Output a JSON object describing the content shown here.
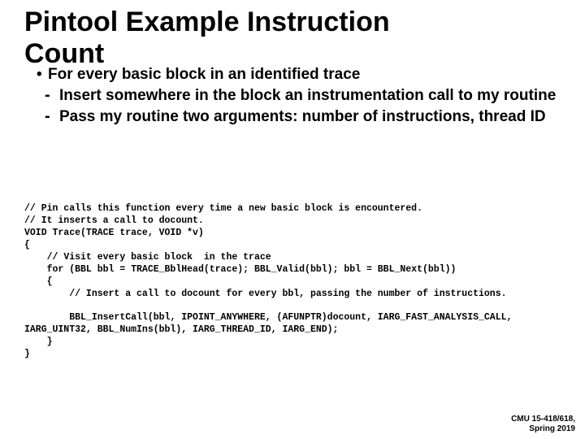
{
  "title_line1": "Pintool Example Instruction",
  "title_line2": "Count",
  "bullet_main": "For every basic block in an identified trace",
  "sub1": "Insert somewhere in the block an instrumentation call to my routine",
  "sub2": "Pass my routine two arguments: number of instructions, thread ID",
  "code": "// Pin calls this function every time a new basic block is encountered.\n// It inserts a call to docount.\nVOID Trace(TRACE trace, VOID *v)\n{\n    // Visit every basic block  in the trace\n    for (BBL bbl = TRACE_BblHead(trace); BBL_Valid(bbl); bbl = BBL_Next(bbl))\n    {\n        // Insert a call to docount for every bbl, passing the number of instructions.\n\n        BBL_InsertCall(bbl, IPOINT_ANYWHERE, (AFUNPTR)docount, IARG_FAST_ANALYSIS_CALL, IARG_UINT32, BBL_NumIns(bbl), IARG_THREAD_ID, IARG_END);\n    }\n}",
  "footer_line1": "CMU 15-418/618,",
  "footer_line2": "Spring 2019"
}
